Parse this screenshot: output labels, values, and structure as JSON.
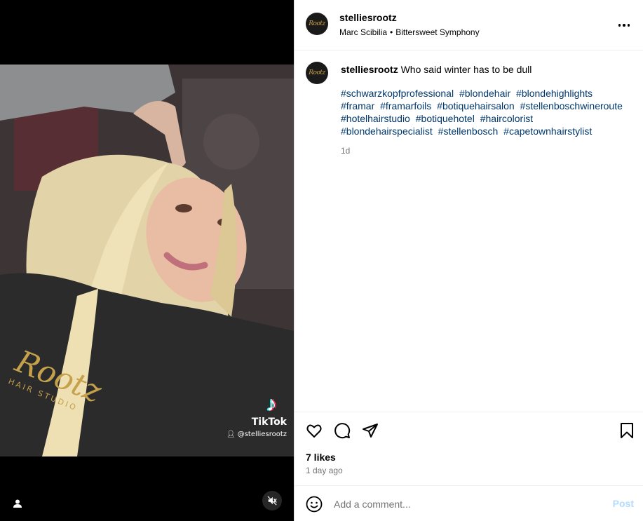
{
  "post": {
    "username": "stelliesrootz",
    "avatar_text": "Rootz",
    "audio_artist": "Marc Scibilia",
    "audio_separator": "•",
    "audio_track": "Bittersweet Symphony"
  },
  "caption": {
    "username": "stelliesrootz",
    "text": "Who said winter has to be dull",
    "hashtags": [
      "#schwarzkopfprofessional",
      "#blondehair",
      "#blondehighlights",
      "#framar",
      "#framarfoils",
      "#botiquehairsalon",
      "#stellenboschwineroute",
      "#hotelhairstudio",
      "#botiquehotel",
      "#haircolorist",
      "#blondehairspecialist",
      "#stellenbosch",
      "#capetownhairstylist"
    ],
    "time": "1d"
  },
  "media": {
    "watermark_app": "TikTok",
    "watermark_user": "@stelliesrootz",
    "apron_brand": "Rootz",
    "apron_sub": "HAIR STUDIO"
  },
  "stats": {
    "likes": "7 likes",
    "posted": "1 day ago"
  },
  "comment": {
    "placeholder": "Add a comment...",
    "post_label": "Post"
  },
  "colors": {
    "hashtag": "#00376b",
    "muted": "#737373",
    "post_disabled": "#b3dbff"
  },
  "icons": [
    "heart-icon",
    "comment-icon",
    "share-icon",
    "bookmark-icon",
    "emoji-icon",
    "more-icon",
    "mute-icon",
    "user-tag-icon",
    "tiktok-icon"
  ]
}
